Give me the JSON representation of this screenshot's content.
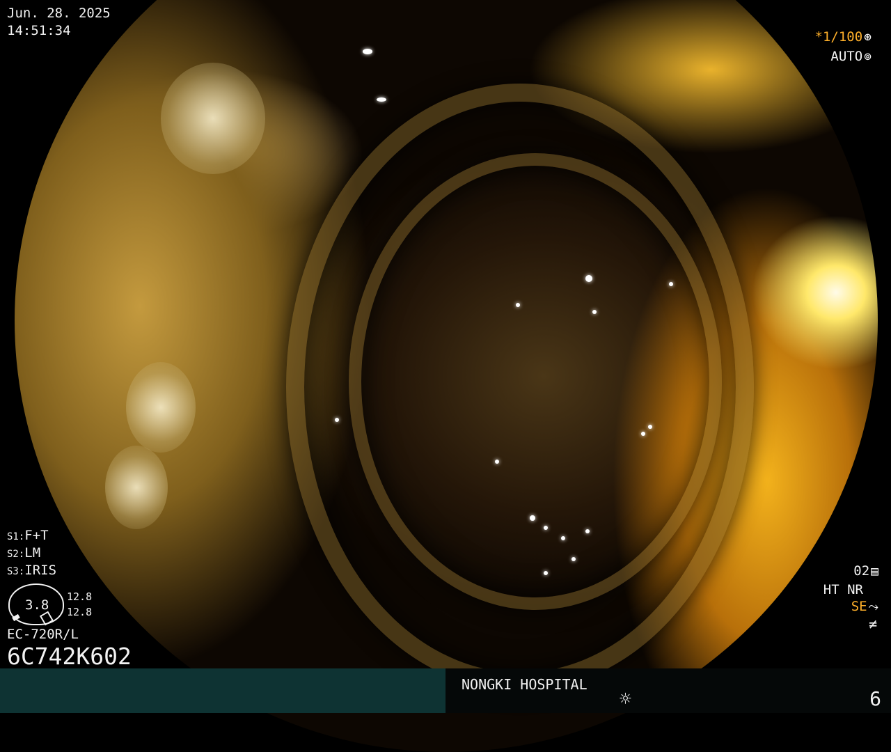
{
  "overlay": {
    "date": "Jun. 28. 2025",
    "time": "14:51:34",
    "shutter": "*1/100",
    "shutter_icon": "aperture-icon",
    "auto": "AUTO",
    "auto_icon": "iris-icon"
  },
  "settings": {
    "s1_key": "S1:",
    "s1_val": "F+T",
    "s2_key": "S2:",
    "s2_val": "LM",
    "s3_key": "S3:",
    "s3_val": "IRIS"
  },
  "dial": {
    "value": "3.8",
    "upper": "12.8",
    "lower": "12.8"
  },
  "scope": {
    "model": "EC-720R/L",
    "serial": "6C742K602"
  },
  "processing": {
    "o2": "02",
    "o2_icon": "structure-enhancement-icon",
    "ht_nr": "HT NR",
    "se": "SE",
    "se_icon": "curve-icon",
    "not_equal": "≠"
  },
  "footer": {
    "hospital": "NONGKI HOSPITAL",
    "light_icon": "sun-icon",
    "page": "6"
  },
  "colors": {
    "accent": "#ffb02a",
    "footer_left": "#0e3333"
  }
}
